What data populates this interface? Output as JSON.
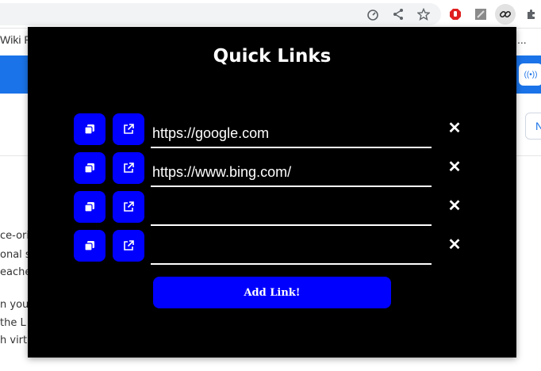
{
  "browser": {
    "toolbar_icons": [
      "performance-icon",
      "share-icon",
      "star-icon"
    ],
    "extensions": [
      "ad-block-icon",
      "notes-extension-icon",
      "quick-links-extension-icon",
      "puzzle-extensions-icon"
    ]
  },
  "background_page": {
    "bookmark_left": "Wiki P",
    "bookmark_right": "...",
    "live_label": "((•))",
    "side_button": "N",
    "text_lines": [
      "ce-ori",
      "onal s",
      "eache",
      "n you",
      "the L",
      "h virtu"
    ]
  },
  "popup": {
    "title": "Quick Links",
    "links": [
      {
        "value": "https://google.com",
        "placeholder": ""
      },
      {
        "value": "https://www.bing.com/",
        "placeholder": ""
      },
      {
        "value": "",
        "placeholder": ""
      },
      {
        "value": "",
        "placeholder": ""
      }
    ],
    "delete_label": "✕",
    "add_button_label": "Add Link!",
    "accent_color": "#0000ff",
    "background_color": "#000000"
  }
}
